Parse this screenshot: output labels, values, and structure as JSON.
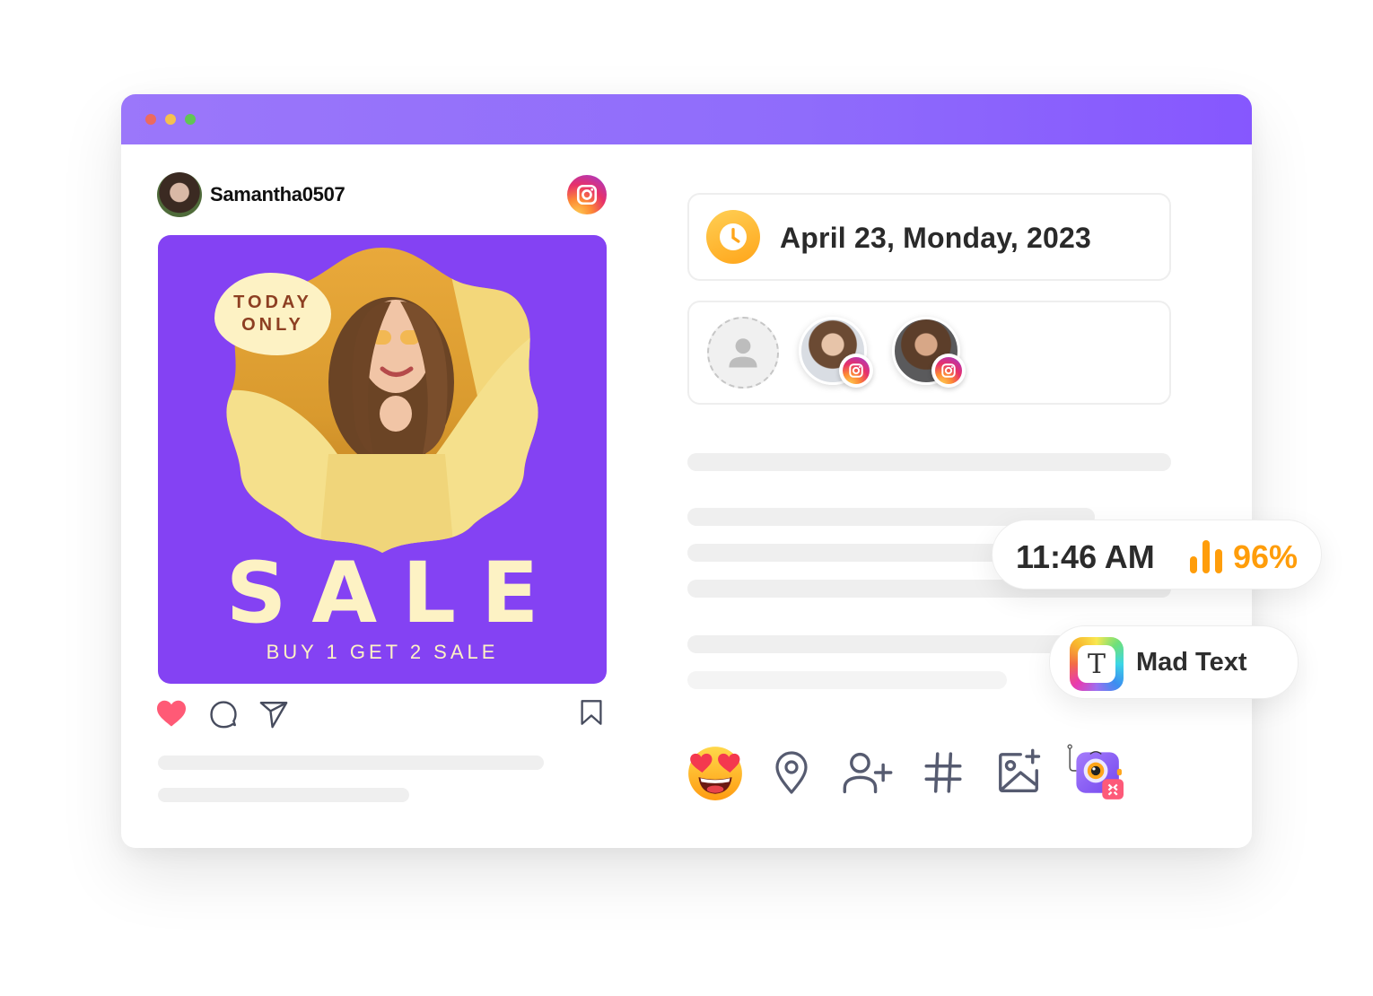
{
  "window": {
    "controls": [
      "close",
      "minimize",
      "maximize"
    ],
    "titlebar_color": "#8f6cfb"
  },
  "post": {
    "username": "Samantha0507",
    "platform_icon": "instagram-icon",
    "image": {
      "badge_line1": "TODAY",
      "badge_line2": "ONLY",
      "headline": "SALE",
      "subheadline": "BUY 1 GET 2 SALE",
      "background_color": "#8442f3"
    },
    "actions": {
      "like": "heart-icon",
      "comment": "comment-icon",
      "share": "send-icon",
      "save": "bookmark-icon",
      "liked": true
    }
  },
  "schedule": {
    "date_icon": "clock-icon",
    "date": "April 23, Monday, 2023",
    "accounts": [
      {
        "type": "placeholder",
        "icon": "user-icon"
      },
      {
        "type": "account",
        "platform": "instagram"
      },
      {
        "type": "account",
        "platform": "instagram"
      }
    ]
  },
  "status_pill": {
    "time": "11:46 AM",
    "signal_icon": "signal-bars-icon",
    "percentage": "96%",
    "accent_color": "#ff9d0a"
  },
  "app_pill": {
    "icon_letter": "T",
    "name": "Mad Text"
  },
  "toolbar": {
    "items": [
      {
        "name": "emoji",
        "icon": "heart-eyes-emoji-icon"
      },
      {
        "name": "location",
        "icon": "location-pin-icon"
      },
      {
        "name": "tag-user",
        "icon": "add-user-icon"
      },
      {
        "name": "hashtag",
        "icon": "hashtag-icon"
      },
      {
        "name": "add-image",
        "icon": "add-image-icon"
      },
      {
        "name": "app-plugin",
        "icon": "camera-app-icon"
      }
    ]
  }
}
